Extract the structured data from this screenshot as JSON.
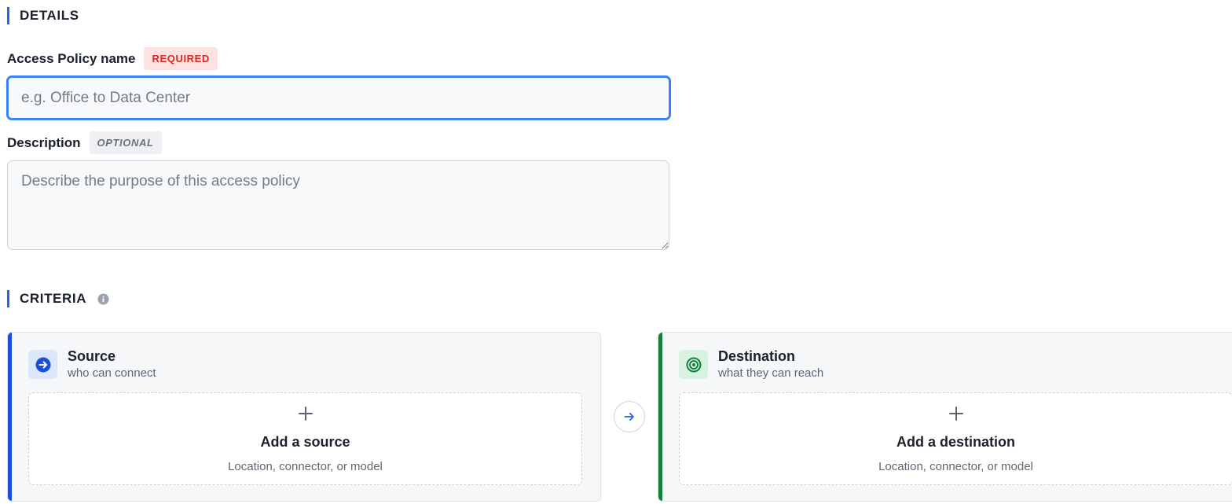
{
  "details": {
    "section_title": "DETAILS",
    "name_label": "Access Policy name",
    "name_badge": "REQUIRED",
    "name_placeholder": "e.g. Office to Data Center",
    "name_value": "",
    "description_label": "Description",
    "description_badge": "OPTIONAL",
    "description_placeholder": "Describe the purpose of this access policy",
    "description_value": ""
  },
  "criteria": {
    "section_title": "CRITERIA",
    "info_icon": "info-icon",
    "flow_icon": "arrow-right-icon",
    "source": {
      "icon": "arrow-right-circle-icon",
      "title": "Source",
      "subtitle": "who can connect",
      "add_icon": "plus-icon",
      "add_label": "Add a source",
      "add_hint": "Location, connector, or model"
    },
    "destination": {
      "icon": "target-icon",
      "title": "Destination",
      "subtitle": "what they can reach",
      "add_icon": "plus-icon",
      "add_label": "Add a destination",
      "add_hint": "Location, connector, or model"
    }
  },
  "colors": {
    "accent": "#2563eb",
    "input_focus": "#3b82f6",
    "source_accent": "#1d4ed8",
    "destination_accent": "#15803d",
    "required_text": "#dc2626",
    "required_bg": "#fde2e2"
  }
}
